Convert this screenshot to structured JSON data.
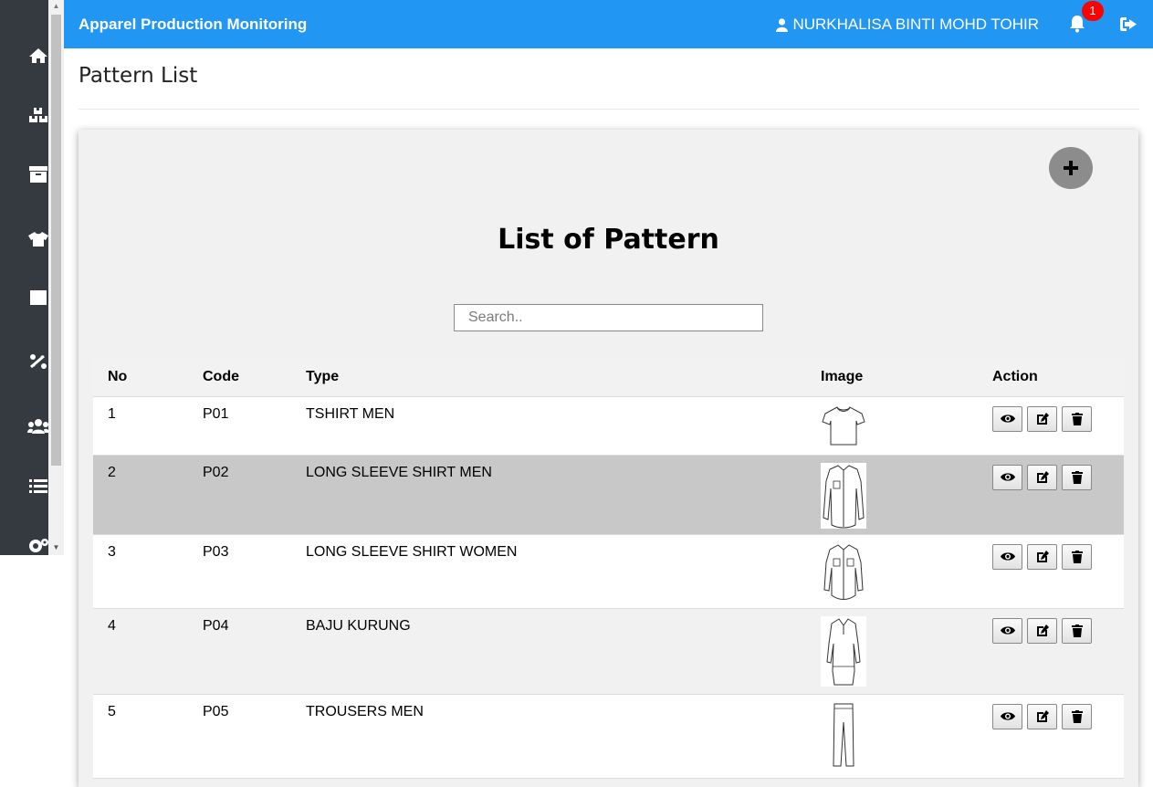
{
  "navbar": {
    "brand": "Apparel Production Monitoring",
    "user_name": "NURKHALISA BINTI MOHD TOHIR",
    "notification_count": "1",
    "accent_color": "#2196f3"
  },
  "sidebar": {
    "icons": [
      "home-icon",
      "boxes-icon",
      "archive-icon",
      "tshirt-icon",
      "square-icon",
      "ruler-icon",
      "users-icon",
      "list-icon",
      "settings-icon"
    ]
  },
  "page": {
    "title": "Pattern List"
  },
  "card": {
    "heading": "List of Pattern",
    "add_label": "+",
    "search_placeholder": "Search.."
  },
  "table": {
    "headers": [
      "No",
      "Code",
      "Type",
      "Image",
      "Action"
    ],
    "rows": [
      {
        "no": "1",
        "code": "P01",
        "type": "TSHIRT MEN",
        "image": "tshirt-sketch"
      },
      {
        "no": "2",
        "code": "P02",
        "type": "LONG SLEEVE SHIRT MEN",
        "image": "long-sleeve-shirt-men-sketch"
      },
      {
        "no": "3",
        "code": "P03",
        "type": "LONG SLEEVE SHIRT WOMEN",
        "image": "long-sleeve-shirt-women-sketch"
      },
      {
        "no": "4",
        "code": "P04",
        "type": "BAJU KURUNG",
        "image": "baju-kurung-sketch"
      },
      {
        "no": "5",
        "code": "P05",
        "type": "TROUSERS MEN",
        "image": "trousers-sketch"
      }
    ]
  }
}
